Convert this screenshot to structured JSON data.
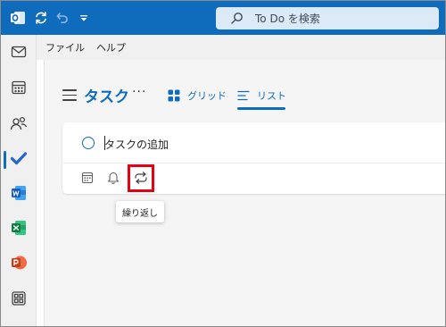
{
  "titlebar": {
    "search_placeholder": "To Do を検索"
  },
  "menubar": {
    "items": [
      "ファイル",
      "ヘルプ"
    ]
  },
  "rail": {
    "items": [
      "メール",
      "予定表",
      "連絡先",
      "To Do",
      "Word",
      "Excel",
      "PowerPoint",
      "アプリ"
    ],
    "active": "To Do"
  },
  "header": {
    "title": "タスク",
    "more": "···",
    "tabs": [
      {
        "label": "グリッド",
        "selected": false
      },
      {
        "label": "リスト",
        "selected": true
      }
    ]
  },
  "add_task": {
    "placeholder": "タスクの追加",
    "tools": [
      "期限",
      "通知",
      "繰り返し"
    ]
  },
  "tooltip": {
    "text": "繰り返し"
  },
  "colors": {
    "accent": "#0f6cbd",
    "highlight": "#e60012"
  }
}
